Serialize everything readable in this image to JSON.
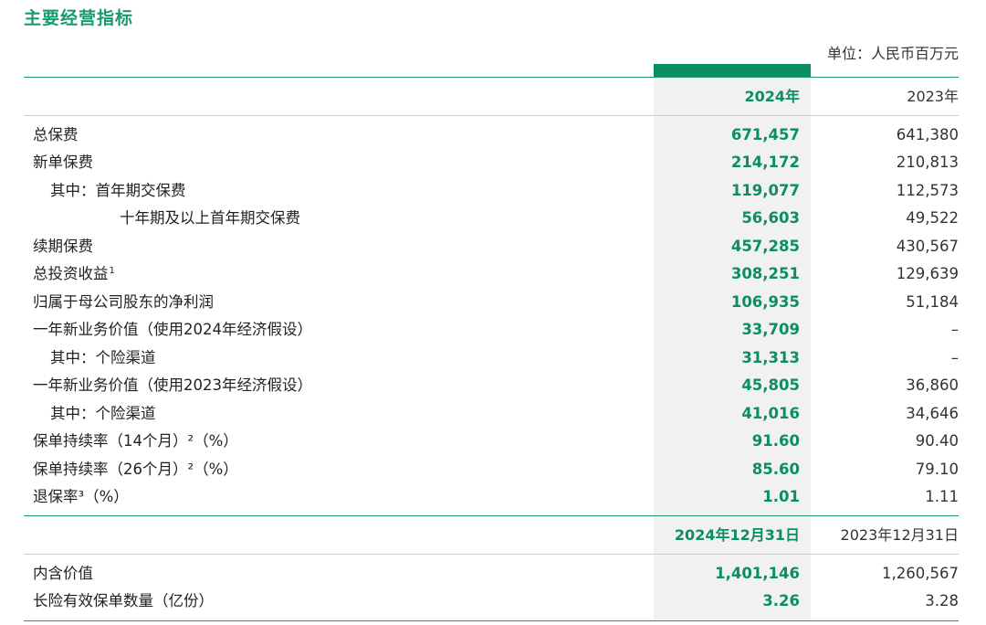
{
  "title": "主要经营指标",
  "unit": "单位：人民币百万元",
  "colors": {
    "accent": "#0c8f5f",
    "title": "#1a9a6c",
    "highlight_bg": "#f1f1f1"
  },
  "header1": {
    "cur": "2024年",
    "prev": "2023年"
  },
  "rows1": [
    {
      "label": "总保费",
      "note": "",
      "cur": "671,457",
      "prev": "641,380"
    },
    {
      "label": "新单保费",
      "note": "",
      "cur": "214,172",
      "prev": "210,813"
    },
    {
      "label": "其中：首年期交保费",
      "note": "",
      "cur": "119,077",
      "prev": "112,573"
    },
    {
      "label": "十年期及以上首年期交保费",
      "note": "",
      "cur": "56,603",
      "prev": "49,522"
    },
    {
      "label": "续期保费",
      "note": "",
      "cur": "457,285",
      "prev": "430,567"
    },
    {
      "label": "总投资收益",
      "note": "1",
      "cur": "308,251",
      "prev": "129,639"
    },
    {
      "label": "归属于母公司股东的净利润",
      "note": "",
      "cur": "106,935",
      "prev": "51,184"
    },
    {
      "label": "一年新业务价值（使用2024年经济假设）",
      "note": "",
      "cur": "33,709",
      "prev": "–"
    },
    {
      "label": "其中：个险渠道",
      "note": "",
      "cur": "31,313",
      "prev": "–"
    },
    {
      "label": "一年新业务价值（使用2023年经济假设）",
      "note": "",
      "cur": "45,805",
      "prev": "36,860"
    },
    {
      "label": "其中：个险渠道",
      "note": "",
      "cur": "41,016",
      "prev": "34,646"
    },
    {
      "label": "保单持续率（14个月）²（%）",
      "note": "",
      "cur": "91.60",
      "prev": "90.40"
    },
    {
      "label": "保单持续率（26个月）²（%）",
      "note": "",
      "cur": "85.60",
      "prev": "79.10"
    },
    {
      "label": "退保率³（%）",
      "note": "",
      "cur": "1.01",
      "prev": "1.11"
    }
  ],
  "header2": {
    "cur": "2024年12月31日",
    "prev": "2023年12月31日"
  },
  "rows2": [
    {
      "label": "内含价值",
      "cur": "1,401,146",
      "prev": "1,260,567"
    },
    {
      "label": "长险有效保单数量（亿份）",
      "cur": "3.26",
      "prev": "3.28"
    }
  ]
}
